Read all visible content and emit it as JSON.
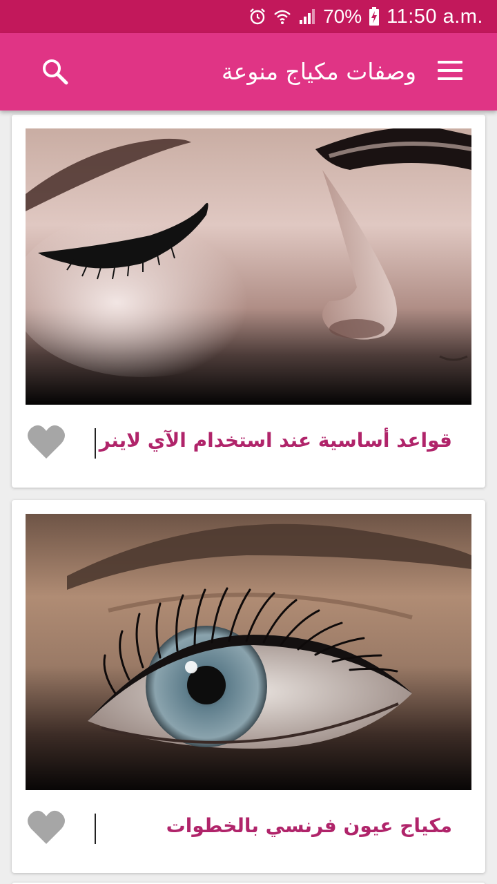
{
  "status_bar": {
    "battery_percent": "70%",
    "time": "11:50 a.m.",
    "icons": [
      "alarm-icon",
      "wifi-icon",
      "signal-icon",
      "battery-charging-icon"
    ]
  },
  "app_bar": {
    "title": "وصفات مكياج منوعة",
    "menu_icon": "hamburger-menu-icon",
    "search_icon": "search-icon"
  },
  "colors": {
    "status_bar": "#c2185b",
    "app_bar": "#e03485",
    "title_text": "#b0246a",
    "favorite_icon": "#a6a6a6",
    "background": "#eeeeee"
  },
  "articles": [
    {
      "title": "قواعد أساسية عند استخدام الآي لاينر",
      "image": "eyeliner-closed-eye-photo",
      "favorite_icon": "heart-icon"
    },
    {
      "title": "مكياج عيون فرنسي بالخطوات",
      "image": "open-eye-lashes-photo",
      "favorite_icon": "heart-icon"
    }
  ]
}
